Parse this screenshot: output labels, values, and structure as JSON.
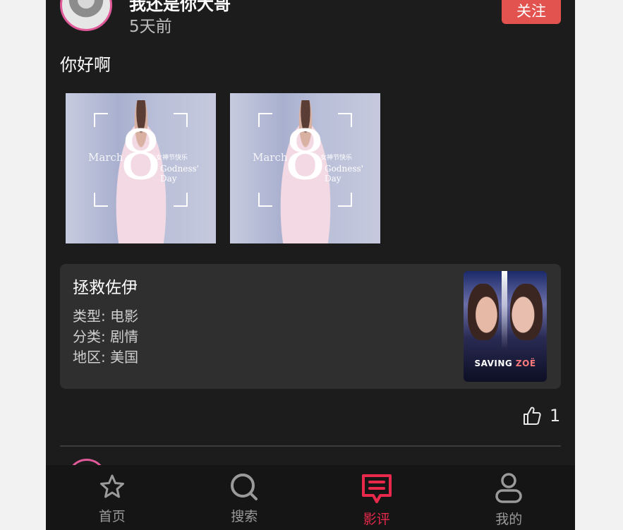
{
  "post": {
    "username": "我还是你大哥",
    "time_ago": "5天前",
    "follow_label": "关注",
    "text": "你好啊",
    "images": [
      {
        "number": "8",
        "caption_left": "March",
        "caption_right_cn": "女神节快乐",
        "caption_right_en": "Godness' Day"
      },
      {
        "number": "8",
        "caption_left": "March",
        "caption_right_cn": "女神节快乐",
        "caption_right_en": "Godness' Day"
      }
    ]
  },
  "movie": {
    "title": "拯救佐伊",
    "type_line": "类型: 电影",
    "category_line": "分类: 剧情",
    "region_line": "地区: 美国",
    "poster_title": "SAVING",
    "poster_title_2": "ZOË"
  },
  "likes": {
    "count": "1"
  },
  "tabbar": {
    "tabs": [
      {
        "label": "首页",
        "icon": "star-icon"
      },
      {
        "label": "搜索",
        "icon": "search-icon"
      },
      {
        "label": "影评",
        "icon": "review-icon",
        "active": true
      },
      {
        "label": "我的",
        "icon": "profile-icon"
      }
    ],
    "active_color": "#e8294c",
    "inactive_color": "#9a9a9a"
  },
  "colors": {
    "background": "#1c1c1c",
    "follow_button": "#e2534f",
    "avatar_ring": "#e05a9a"
  }
}
